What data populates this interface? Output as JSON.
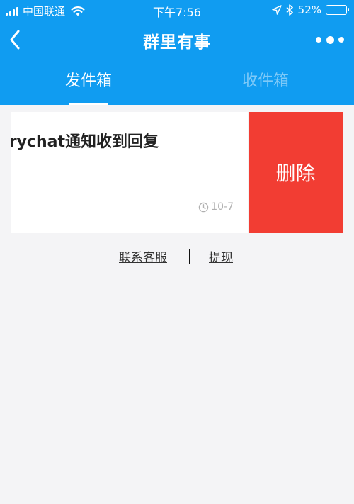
{
  "status_bar": {
    "carrier": "中国联通",
    "time": "下午7:56",
    "battery_percent": "52%",
    "battery_level": 0.52,
    "icons": [
      "signal-icon",
      "wifi-icon",
      "location-icon",
      "bluetooth-icon",
      "battery-icon"
    ]
  },
  "nav": {
    "title": "群里有事",
    "back_icon": "chevron-left-icon",
    "more_icon": "more-dots-icon"
  },
  "tabs": {
    "items": [
      {
        "label": "发件箱",
        "active": true
      },
      {
        "label": "收件箱",
        "active": false
      }
    ]
  },
  "message": {
    "title": "Marychat通知收到回复",
    "date": "10-7",
    "time_icon": "clock-icon"
  },
  "swipe_action": {
    "delete_label": "删除"
  },
  "links": {
    "service": "联系客服",
    "withdraw": "提现"
  },
  "colors": {
    "header_bg": "#109cf1",
    "delete_bg": "#f23d33",
    "page_bg": "#f4f4f6"
  }
}
